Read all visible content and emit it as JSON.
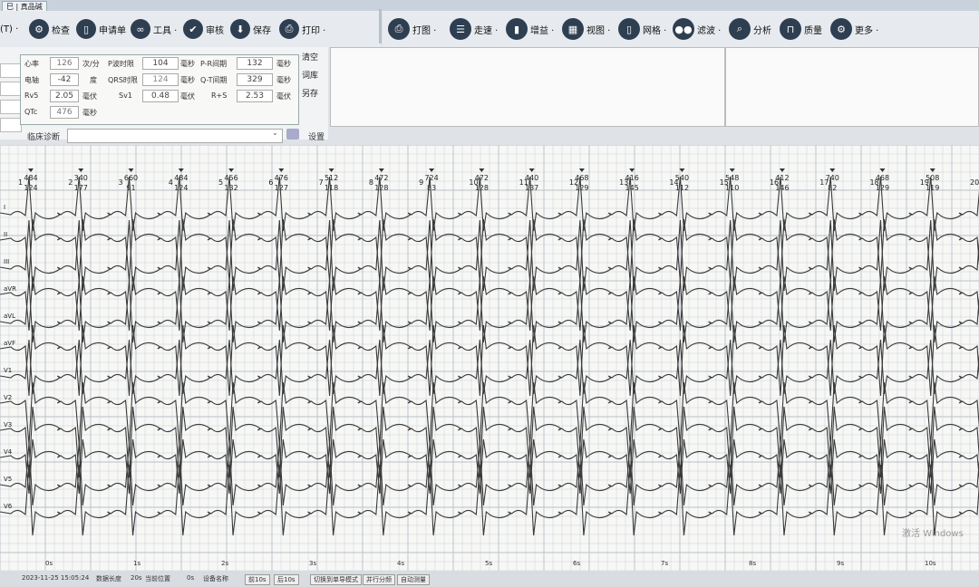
{
  "window": {
    "tab_label": "巳 | 真品碱"
  },
  "toolbar_left": {
    "prefix": "(T) ·",
    "items": [
      {
        "label": "检查",
        "icon": "gear-icon"
      },
      {
        "label": "申请单",
        "icon": "document-icon"
      },
      {
        "label": "工具 ·",
        "icon": "tools-icon"
      },
      {
        "label": "审核",
        "icon": "check-icon"
      },
      {
        "label": "保存",
        "icon": "save-icon"
      },
      {
        "label": "打印 ·",
        "icon": "print-icon"
      }
    ]
  },
  "toolbar_right": {
    "items": [
      {
        "label": "打图 ·",
        "icon": "print-icon"
      },
      {
        "label": "走速 ·",
        "icon": "speed-icon"
      },
      {
        "label": "增益 ·",
        "icon": "bar-chart-icon"
      },
      {
        "label": "视图 ·",
        "icon": "view-icon"
      },
      {
        "label": "网格 ·",
        "icon": "grid-icon"
      },
      {
        "label": "滤波 ·",
        "icon": "filter-icon"
      },
      {
        "label": "分析",
        "icon": "search-icon"
      },
      {
        "label": "质量",
        "icon": "quality-icon"
      },
      {
        "label": "更多 ·",
        "icon": "more-icon"
      }
    ]
  },
  "measurements": {
    "hr_label": "心率",
    "hr_value": "126",
    "hr_unit": "次/分",
    "p_label": "P波时限",
    "p_value": "104",
    "p_unit": "毫秒",
    "pr_label": "P-R间期",
    "pr_value": "132",
    "pr_unit": "毫秒",
    "axis_label": "电轴",
    "axis_value": "-42",
    "axis_unit": "度",
    "qrs_label": "QRS时限",
    "qrs_value": "124",
    "qrs_unit": "毫秒",
    "qt_label": "Q-T间期",
    "qt_value": "329",
    "qt_unit": "毫秒",
    "rv5_label": "Rv5",
    "rv5_value": "2.05",
    "rv5_unit": "毫伏",
    "sv1_label": "Sv1",
    "sv1_value": "0.48",
    "sv1_unit": "毫伏",
    "rs_label": "R+S",
    "rs_value": "2.53",
    "rs_unit": "毫伏",
    "qtc_label": "QTc",
    "qtc_value": "476",
    "qtc_unit": "毫秒"
  },
  "side_buttons": [
    "清空",
    "词库",
    "另存"
  ],
  "diagnosis": {
    "label": "临床诊断",
    "settings": "设置"
  },
  "ecg": {
    "beats": [
      {
        "n": "1",
        "rr": "484",
        "hr": "124"
      },
      {
        "n": "2",
        "rr": "340",
        "hr": "177"
      },
      {
        "n": "3",
        "rr": "660",
        "hr": "91"
      },
      {
        "n": "4",
        "rr": "484",
        "hr": "124"
      },
      {
        "n": "5",
        "rr": "456",
        "hr": "132"
      },
      {
        "n": "6",
        "rr": "476",
        "hr": "127"
      },
      {
        "n": "7",
        "rr": "512",
        "hr": "118"
      },
      {
        "n": "8",
        "rr": "472",
        "hr": "128"
      },
      {
        "n": "9",
        "rr": "724",
        "hr": "83"
      },
      {
        "n": "10",
        "rr": "472",
        "hr": "128"
      },
      {
        "n": "11",
        "rr": "440",
        "hr": "137"
      },
      {
        "n": "12",
        "rr": "468",
        "hr": "129"
      },
      {
        "n": "13",
        "rr": "416",
        "hr": "145"
      },
      {
        "n": "14",
        "rr": "540",
        "hr": "112"
      },
      {
        "n": "15",
        "rr": "548",
        "hr": "110"
      },
      {
        "n": "16",
        "rr": "412",
        "hr": "146"
      },
      {
        "n": "17",
        "rr": "740",
        "hr": "82"
      },
      {
        "n": "18",
        "rr": "468",
        "hr": "129"
      },
      {
        "n": "19",
        "rr": "508",
        "hr": "119"
      },
      {
        "n": "20",
        "rr": "",
        "hr": ""
      }
    ],
    "leads": [
      "I",
      "II",
      "III",
      "aVR",
      "aVL",
      "aVF",
      "V1",
      "V2",
      "V3",
      "V4",
      "V5",
      "V6"
    ],
    "time_ticks": [
      "0s",
      "1s",
      "2s",
      "3s",
      "4s",
      "5s",
      "6s",
      "7s",
      "8s",
      "9s",
      "10s"
    ],
    "watermark": "激活 Windows",
    "colors": {
      "grid": "#b7c0cc",
      "trace": "#3a3a3a"
    }
  },
  "status_bar": {
    "datetime": "2023-11-25 15:05:24",
    "gain_label": "数据长度",
    "gain_value": "20s",
    "pos_label": "当前位置",
    "pos_value": "0s",
    "device_label": "设备名称",
    "btn_prev": "前10s",
    "btn_next": "后10s",
    "btn_mode": "切换到单导模式",
    "btn_parallel": "并行分频",
    "btn_auto": "自动测量"
  }
}
